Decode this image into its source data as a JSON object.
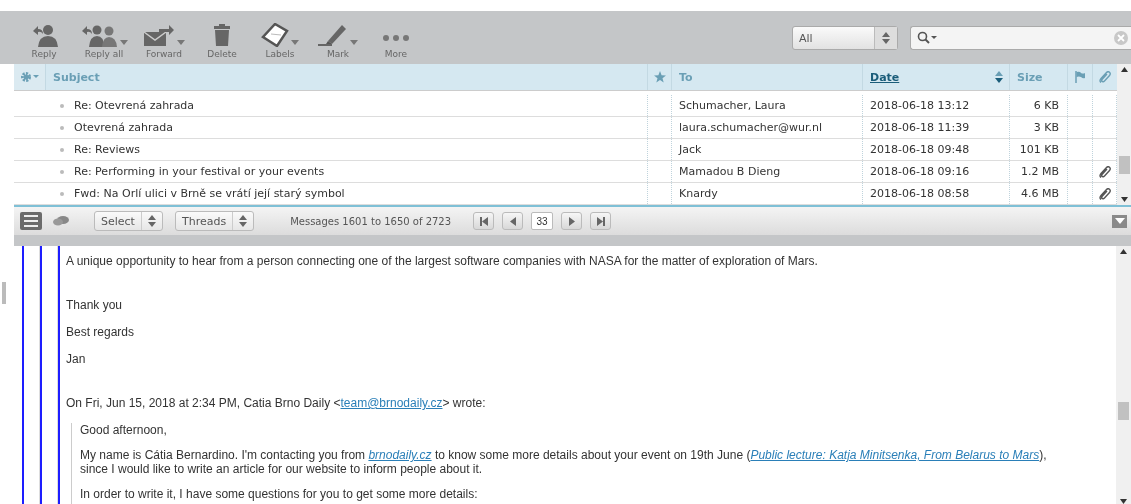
{
  "toolbar": {
    "buttons": [
      {
        "label": "Reply",
        "menu": false
      },
      {
        "label": "Reply all",
        "menu": true
      },
      {
        "label": "Forward",
        "menu": true
      },
      {
        "label": "Delete",
        "menu": false
      },
      {
        "label": "Labels",
        "menu": true
      },
      {
        "label": "Mark",
        "menu": true
      },
      {
        "label": "More",
        "menu": false
      }
    ],
    "filter": {
      "value": "All"
    }
  },
  "list": {
    "columns": [
      {
        "kind": "options"
      },
      {
        "kind": "text",
        "label": "Subject",
        "sorted": false
      },
      {
        "kind": "star"
      },
      {
        "kind": "text",
        "label": "To",
        "sorted": false
      },
      {
        "kind": "text",
        "label": "Date",
        "sorted": true
      },
      {
        "kind": "text",
        "label": "Size",
        "sorted": false
      },
      {
        "kind": "flag"
      },
      {
        "kind": "attachment"
      }
    ],
    "rows": [
      {
        "subject": "Re: Otevrená zahrada",
        "to": "Schumacher, Laura",
        "date": "2018-06-18 13:12",
        "size": "6 KB",
        "attachment": false
      },
      {
        "subject": "Otevrená zahrada",
        "to": "laura.schumacher@wur.nl",
        "date": "2018-06-18 11:39",
        "size": "3 KB",
        "attachment": false
      },
      {
        "subject": "Re: Reviews",
        "to": "Jack",
        "date": "2018-06-18 09:48",
        "size": "101 KB",
        "attachment": false
      },
      {
        "subject": "Re: Performing in your festival or your events",
        "to": "Mamadou B Dieng",
        "date": "2018-06-18 09:16",
        "size": "1.2 MB",
        "attachment": true
      },
      {
        "subject": "Fwd: Na Orlí ulici v Brně se vrátí její starý symbol",
        "to": "Knardy",
        "date": "2018-06-18 08:58",
        "size": "4.6 MB",
        "attachment": true
      }
    ]
  },
  "pager": {
    "select": "Select",
    "threads": "Threads",
    "count": "Messages 1601 to 1650 of 2723",
    "page": "33"
  },
  "message": {
    "paragraphs": [
      {
        "quoted": false,
        "gap": false,
        "parts": [
          {
            "kind": "text",
            "text": "A unique opportunity to hear from a person connecting one of the largest software companies with NASA for the matter of exploration of Mars."
          }
        ]
      },
      {
        "quoted": false,
        "gap": true,
        "parts": [
          {
            "kind": "text",
            "text": "Thank you"
          }
        ]
      },
      {
        "quoted": false,
        "gap": false,
        "parts": [
          {
            "kind": "text",
            "text": "Best regards"
          }
        ]
      },
      {
        "quoted": false,
        "gap": false,
        "parts": [
          {
            "kind": "text",
            "text": "Jan"
          }
        ]
      },
      {
        "quoted": false,
        "gap": true,
        "parts": [
          {
            "kind": "text",
            "text": "On Fri, Jun 15, 2018 at 2:34 PM, Catia Brno Daily <"
          },
          {
            "kind": "link",
            "text": "team@brnodaily.cz"
          },
          {
            "kind": "text",
            "text": "> wrote:"
          }
        ]
      },
      {
        "quoted": true,
        "gap": false,
        "parts": [
          {
            "kind": "text",
            "text": "Good afternoon,"
          }
        ]
      },
      {
        "quoted": true,
        "gap": false,
        "parts": [
          {
            "kind": "text",
            "text": "My name is Cátia Bernardino. I'm contacting you from "
          },
          {
            "kind": "link",
            "text": "brnodaily.cz"
          },
          {
            "kind": "text",
            "text": " to know some more details about your event on 19th June ("
          },
          {
            "kind": "link",
            "text": "Public lecture: Katja Minitsenka, From Belarus to Mars"
          },
          {
            "kind": "text",
            "text": "), since I would like to write an article for our website to inform people about it."
          }
        ]
      },
      {
        "quoted": true,
        "gap": false,
        "parts": [
          {
            "kind": "text",
            "text": "In order to write it, I have some questions for you to get some more details:"
          }
        ]
      }
    ]
  }
}
